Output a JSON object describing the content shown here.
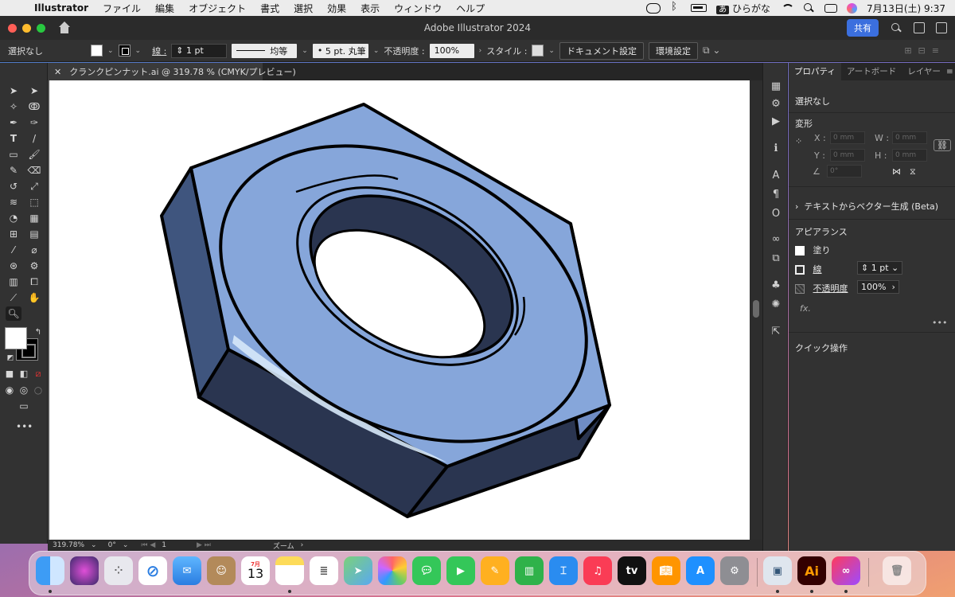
{
  "menubar": {
    "app_name": "Illustrator",
    "items": [
      "ファイル",
      "編集",
      "オブジェクト",
      "書式",
      "選択",
      "効果",
      "表示",
      "ウィンドウ",
      "ヘルプ"
    ],
    "input_mode": "あ",
    "input_mode_label": "ひらがな",
    "datetime": "7月13日(土) 9:37"
  },
  "window": {
    "title": "Adobe Illustrator 2024",
    "share_label": "共有"
  },
  "controlbar": {
    "selection_status": "選択なし",
    "stroke_label": "線 :",
    "stroke_weight": "1 pt",
    "stroke_profile": "均等",
    "brush": "5 pt. 丸筆",
    "opacity_label": "不透明度 :",
    "opacity_value": "100%",
    "style_label": "スタイル :",
    "document_settings": "ドキュメント設定",
    "preferences": "環境設定"
  },
  "document": {
    "tab_title": "クランクピンナット.ai @ 319.78 % (CMYK/プレビュー)"
  },
  "statusbar": {
    "zoom": "319.78%",
    "rotation": "0°",
    "artboard": "1",
    "tool": "ズーム"
  },
  "properties": {
    "tabs": [
      "プロパティ",
      "アートボード",
      "レイヤー"
    ],
    "selection_status": "選択なし",
    "transform_heading": "変形",
    "x_label": "X :",
    "y_label": "Y :",
    "w_label": "W :",
    "h_label": "H :",
    "x_value": "0 mm",
    "y_value": "0 mm",
    "w_value": "0 mm",
    "h_value": "0 mm",
    "angle_value": "0°",
    "text_to_vector": "テキストからベクター生成 (Beta)",
    "appearance_heading": "アピアランス",
    "fill_label": "塗り",
    "stroke_label": "線",
    "stroke_value": "1 pt",
    "opacity_label": "不透明度",
    "opacity_value": "100%",
    "fx_label": "fx.",
    "quick_actions_heading": "クイック操作"
  },
  "artwork": {
    "subject": "hex-nut",
    "colors": {
      "face": "#86a6da",
      "side_dark": "#2a3550",
      "side_mid": "#3f557e",
      "side_light": "#6f8cc4",
      "chamfer": "#d6e8f8",
      "outline": "#000000"
    }
  },
  "dock": {
    "apps": [
      "finder",
      "siri",
      "launchpad",
      "safari",
      "mail",
      "contacts",
      "calendar",
      "notes",
      "reminders",
      "maps",
      "photos",
      "messages",
      "facetime",
      "freeform",
      "numbers",
      "keynote",
      "music",
      "tv",
      "books",
      "app-store",
      "system-settings",
      "preview",
      "illustrator",
      "creative-cloud",
      "trash"
    ],
    "calendar_month": "7月",
    "calendar_day": "13"
  },
  "accent_color": "#3b6fde"
}
